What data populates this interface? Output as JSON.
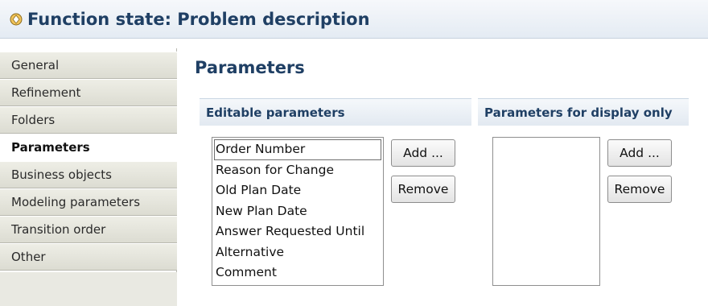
{
  "window": {
    "title": "Function state: Problem description",
    "icon": "function-state-icon"
  },
  "sidebar": {
    "items": [
      {
        "label": "General",
        "active": false
      },
      {
        "label": "Refinement",
        "active": false
      },
      {
        "label": "Folders",
        "active": false
      },
      {
        "label": "Parameters",
        "active": true
      },
      {
        "label": "Business objects",
        "active": false
      },
      {
        "label": "Modeling parameters",
        "active": false
      },
      {
        "label": "Transition order",
        "active": false
      },
      {
        "label": "Other",
        "active": false
      }
    ]
  },
  "main": {
    "title": "Parameters",
    "editable": {
      "header": "Editable parameters",
      "items": [
        "Order Number",
        "Reason for Change",
        "Old Plan Date",
        "New Plan Date",
        "Answer Requested Until",
        "Alternative",
        "Comment"
      ],
      "selected_index": 0,
      "add_label": "Add ...",
      "remove_label": "Remove"
    },
    "display_only": {
      "header": "Parameters for display only",
      "items": [],
      "add_label": "Add ...",
      "remove_label": "Remove"
    }
  },
  "colors": {
    "heading": "#1f3f64",
    "nav_bg": "#e6e6dc",
    "header_bg": "#e8eef5"
  }
}
